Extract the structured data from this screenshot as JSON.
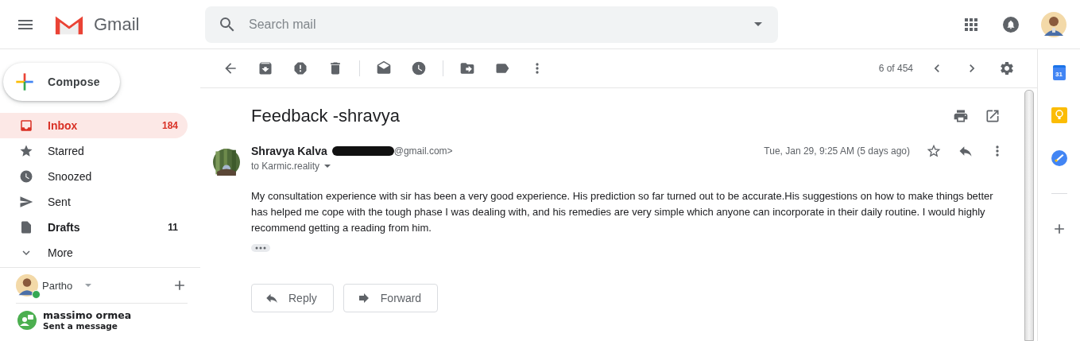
{
  "app": {
    "name": "Gmail"
  },
  "search": {
    "placeholder": "Search mail"
  },
  "compose": {
    "label": "Compose"
  },
  "nav": [
    {
      "label": "Inbox",
      "count": "184",
      "selected": true,
      "bold": true
    },
    {
      "label": "Starred",
      "selected": false,
      "bold": false
    },
    {
      "label": "Snoozed",
      "selected": false,
      "bold": false
    },
    {
      "label": "Sent",
      "selected": false,
      "bold": false
    },
    {
      "label": "Drafts",
      "count": "11",
      "selected": false,
      "bold": true
    },
    {
      "label": "More",
      "selected": false,
      "bold": false
    }
  ],
  "chat": {
    "user": {
      "name": "Partho",
      "online": true
    },
    "contacts": [
      {
        "name": "massimo ormea",
        "status": "Sent a message"
      }
    ]
  },
  "toolbar": {
    "position": "6 of 454"
  },
  "message": {
    "subject": "Feedback -shravya",
    "sender": "Shravya Kalva",
    "email": "@gmail.com>",
    "to": "to Karmic.reality",
    "date": "Tue, Jan 29, 9:25 AM (5 days ago)",
    "starred": false,
    "body": "My consultation experience with sir has been a very good experience. His prediction so far turned out to be accurate.His suggestions on how to make things better has helped me cope with the tough phase I was dealing with, and his remedies are very simple which anyone can incorporate in their daily routine. I would highly recommend getting a reading from him.",
    "actions": [
      {
        "label": "Reply"
      },
      {
        "label": "Forward"
      }
    ]
  },
  "side_rail": {
    "calendar_day": "31"
  }
}
